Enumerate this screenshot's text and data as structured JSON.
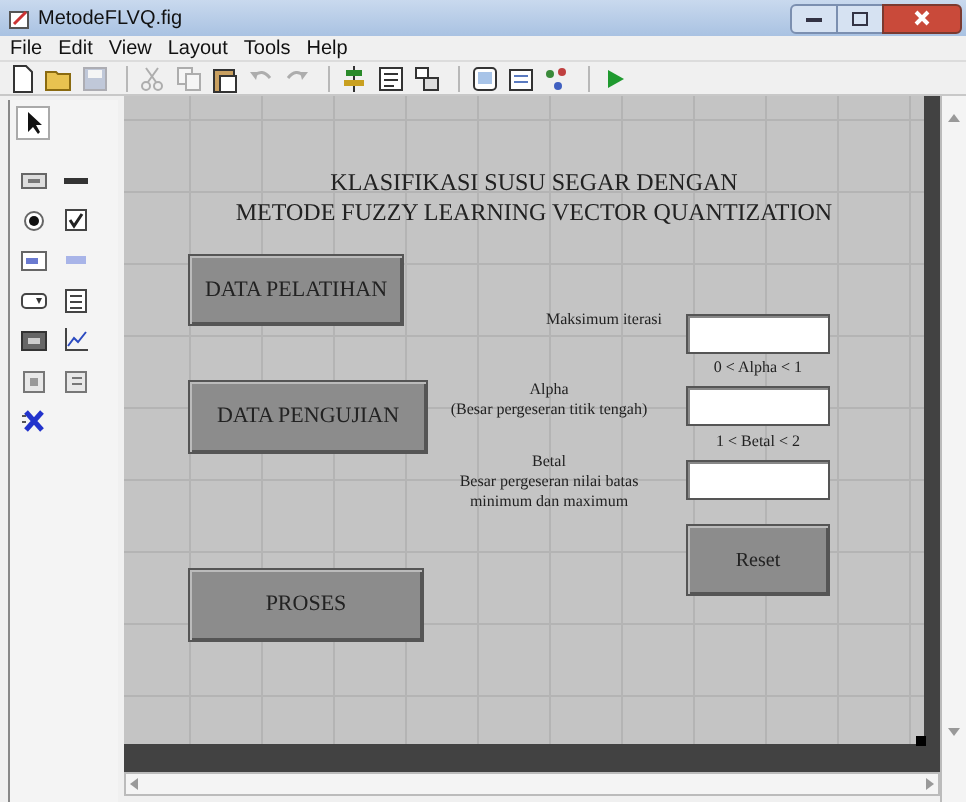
{
  "window": {
    "title": "MetodeFLVQ.fig"
  },
  "menu": [
    "File",
    "Edit",
    "View",
    "Layout",
    "Tools",
    "Help"
  ],
  "toolbar": [
    [
      {
        "disabled": false
      },
      {
        "disabled": false
      },
      {
        "disabled": true
      }
    ],
    [
      {
        "disabled": true
      },
      {
        "disabled": true
      },
      {
        "disabled": false
      },
      {
        "disabled": true
      },
      {
        "disabled": true
      }
    ],
    [
      {
        "disabled": false
      },
      {
        "disabled": false
      },
      {
        "disabled": false
      }
    ],
    [
      {
        "disabled": false
      },
      {
        "disabled": false
      },
      {
        "disabled": false
      }
    ],
    [
      {
        "disabled": false
      }
    ]
  ],
  "palette": [
    {
      "selected": true
    },
    {
      "selected": false
    },
    {
      "selected": false
    },
    {
      "selected": false
    },
    {
      "selected": false
    },
    {
      "selected": false
    },
    {
      "selected": false
    },
    {
      "selected": false
    },
    {
      "selected": false
    },
    {
      "selected": false
    },
    {
      "selected": false
    },
    {
      "selected": false
    },
    {
      "selected": false
    },
    {
      "selected": false
    }
  ],
  "canvas": {
    "title_lines": [
      "KLASIFIKASI SUSU SEGAR DENGAN",
      "METODE FUZZY LEARNING VECTOR QUANTIZATION"
    ],
    "buttons": [
      {
        "label": "DATA PELATIHAN"
      },
      {
        "label": "DATA PENGUJIAN"
      },
      {
        "label": "PROSES"
      },
      {
        "label": "Reset"
      }
    ],
    "fields": [
      {
        "label_lines": [
          "Maksimum iterasi"
        ]
      },
      {
        "range": "0 < Alpha < 1",
        "label_lines": [
          "Alpha",
          "(Besar pergeseran titik tengah)"
        ]
      },
      {
        "range": "1 < Betal < 2",
        "label_lines": [
          "Betal",
          "Besar pergeseran nilai batas",
          "minimum dan maximum"
        ]
      }
    ]
  }
}
